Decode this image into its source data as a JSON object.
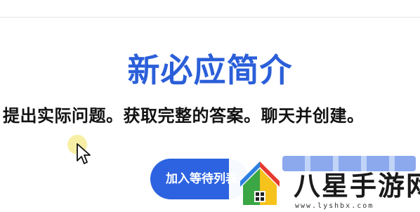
{
  "hero": {
    "title": "新必应简介",
    "subtitle": "提出实际问题。获取完整的答案。聊天并创建。"
  },
  "cta": {
    "waitlist_label": "加入等待列表"
  },
  "watermark": {
    "brand": "八星手游网",
    "url": "www.lyshbx.com",
    "logo_icon": "house-logo-icon",
    "colors": {
      "red": "#e63a2f",
      "green": "#3aa744",
      "blue": "#2d7fe0",
      "yellow": "#f6c21c"
    }
  },
  "colors": {
    "accent": "#2b5fd9",
    "button": "#2d63e0"
  }
}
